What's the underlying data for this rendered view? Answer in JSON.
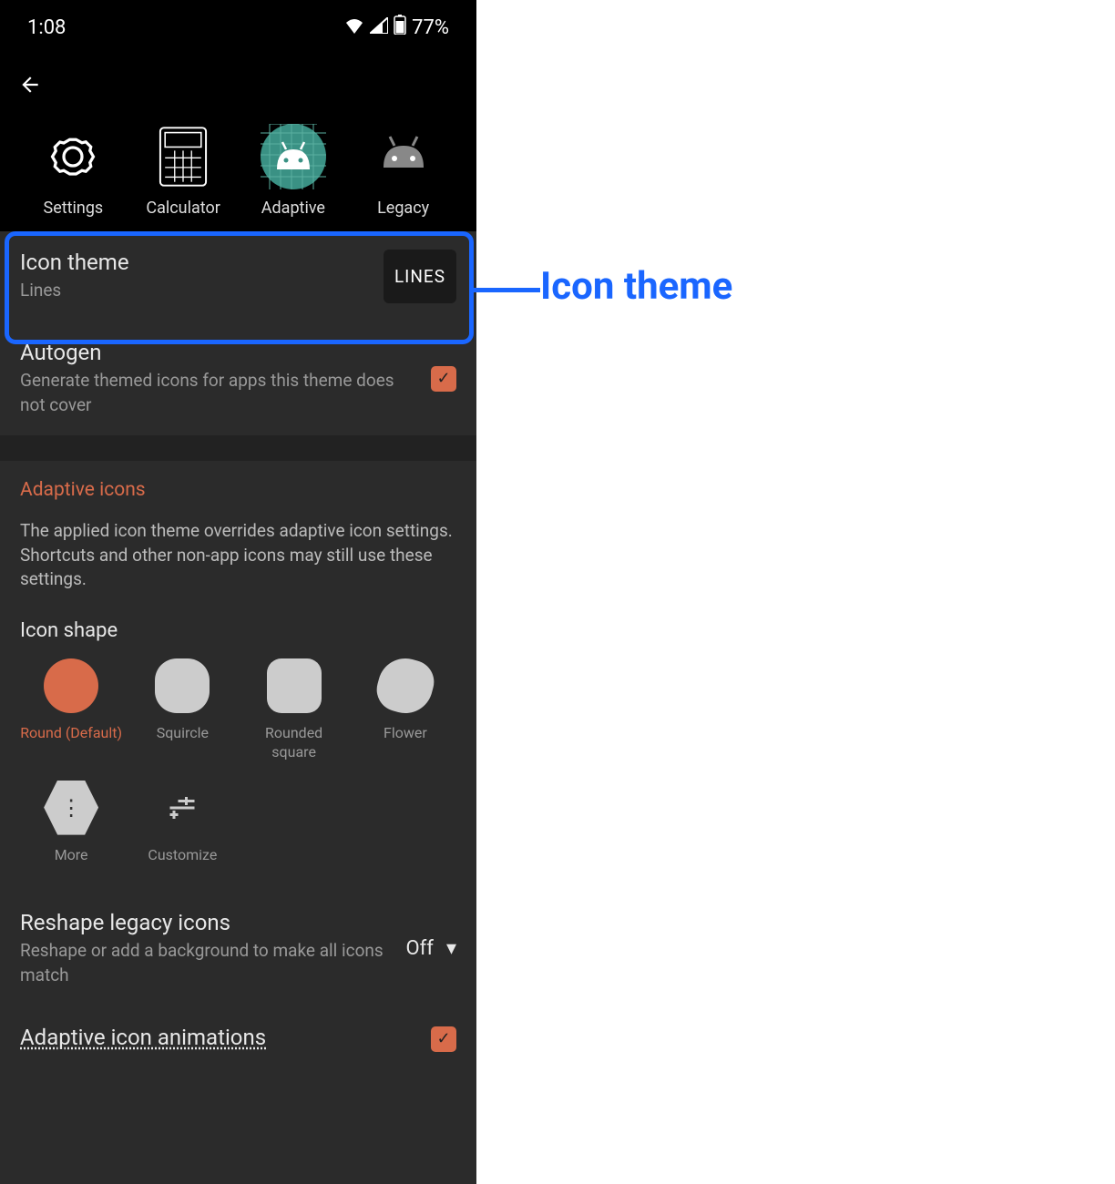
{
  "status": {
    "time": "1:08",
    "battery": "77%"
  },
  "preview": [
    {
      "label": "Settings",
      "icon": "gear"
    },
    {
      "label": "Calculator",
      "icon": "calculator"
    },
    {
      "label": "Adaptive",
      "icon": "android-adaptive"
    },
    {
      "label": "Legacy",
      "icon": "android-legacy"
    }
  ],
  "settings": {
    "icon_theme": {
      "title": "Icon theme",
      "value": "Lines",
      "badge": "LINES"
    },
    "autogen": {
      "title": "Autogen",
      "desc": "Generate themed icons for apps this theme does not cover",
      "checked": true
    }
  },
  "adaptive": {
    "header": "Adaptive icons",
    "desc": "The applied icon theme overrides adaptive icon settings. Shortcuts and other non-app icons may still use these settings.",
    "shape_label": "Icon shape",
    "shapes": [
      {
        "name": "Round (Default)",
        "active": true
      },
      {
        "name": "Squircle"
      },
      {
        "name": "Rounded square"
      },
      {
        "name": "Flower"
      }
    ],
    "extras": [
      {
        "name": "More"
      },
      {
        "name": "Customize"
      }
    ],
    "reshape": {
      "title": "Reshape legacy icons",
      "desc": "Reshape or add a background to make all icons match",
      "value": "Off"
    },
    "animations": {
      "title": "Adaptive icon animations",
      "checked": true
    }
  },
  "callout": "Icon theme"
}
